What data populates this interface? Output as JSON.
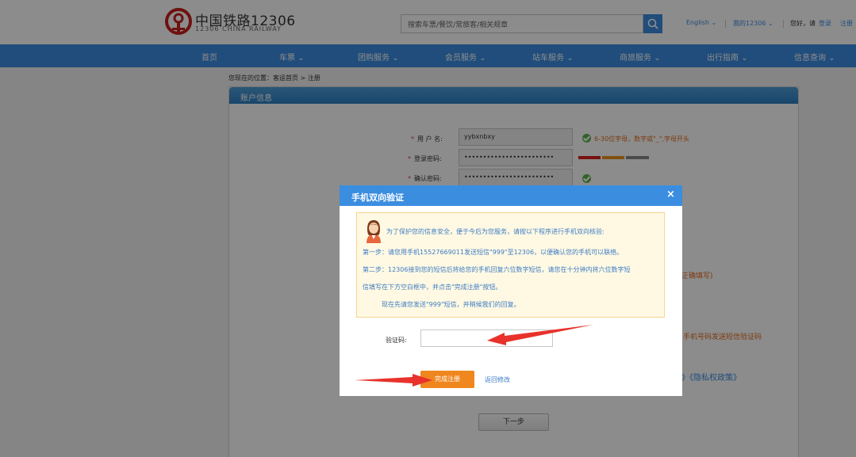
{
  "header": {
    "logo_cn": "中国铁路12306",
    "logo_en": "12306 CHINA RAILWAY",
    "search_placeholder": "搜索车票/餐饮/常旅客/相关规章",
    "language": "English",
    "my_account": "我的12306",
    "greeting": "您好，请",
    "login": "登录",
    "register": "注册"
  },
  "nav": {
    "items": [
      {
        "label": "首页",
        "dropdown": false
      },
      {
        "label": "车票",
        "dropdown": true
      },
      {
        "label": "团购服务",
        "dropdown": true
      },
      {
        "label": "会员服务",
        "dropdown": true
      },
      {
        "label": "站车服务",
        "dropdown": true
      },
      {
        "label": "商旅服务",
        "dropdown": true
      },
      {
        "label": "出行指南",
        "dropdown": true
      },
      {
        "label": "信息查询",
        "dropdown": true
      }
    ]
  },
  "breadcrumb": "您现在的位置：客运首页 > 注册",
  "form": {
    "panel_title": "账户信息",
    "username_label": "用 户 名:",
    "username_value": "yybxnbxy",
    "username_hint": "6-30位字母，数字或\"_\",字母开头",
    "password_label": "登录密码:",
    "password_value": "••••••••••••••••••••••••",
    "confirm_label": "确认密码:",
    "confirm_value": "••••••••••••••••••••••••",
    "peek_fill_hint": "正确填写)",
    "peek_sms_hint": "手机号码发送短信验证码",
    "peek_privacy": "》《隐私权政策》",
    "next_button": "下一步"
  },
  "modal": {
    "title": "手机双向验证",
    "close": "×",
    "notice_intro": "为了保护您的信息安全，便于今后为您服务，请按以下程序进行手机双向核验:",
    "step1": "第一步：请您用手机15527669011发送短信\"999\"至12306，以便确认您的手机可以联络。",
    "step2_line1": "第二步：12306接到您的短信后将给您的手机回复六位数字短信，请您在十分钟内将六位数字短",
    "step2_line2": "信填写在下方空白框中，并点击\"完成注册\"按钮。",
    "send_now": "现在先请您发送\"999\"短信，并稍候我们的回复。",
    "code_label": "验证码:",
    "code_value": "",
    "complete_button": "完成注册",
    "back_link": "返回修改"
  },
  "colors": {
    "brand_blue": "#3b8de0",
    "action_orange": "#f0861e",
    "logo_red": "#c8201d",
    "notice_bg": "#fff9e3",
    "annotation_red": "#e8322b"
  },
  "icons": [
    "logo-icon",
    "search-icon",
    "chevron-down-icon",
    "check-icon",
    "avatar-icon",
    "close-icon",
    "arrow-annotation"
  ]
}
